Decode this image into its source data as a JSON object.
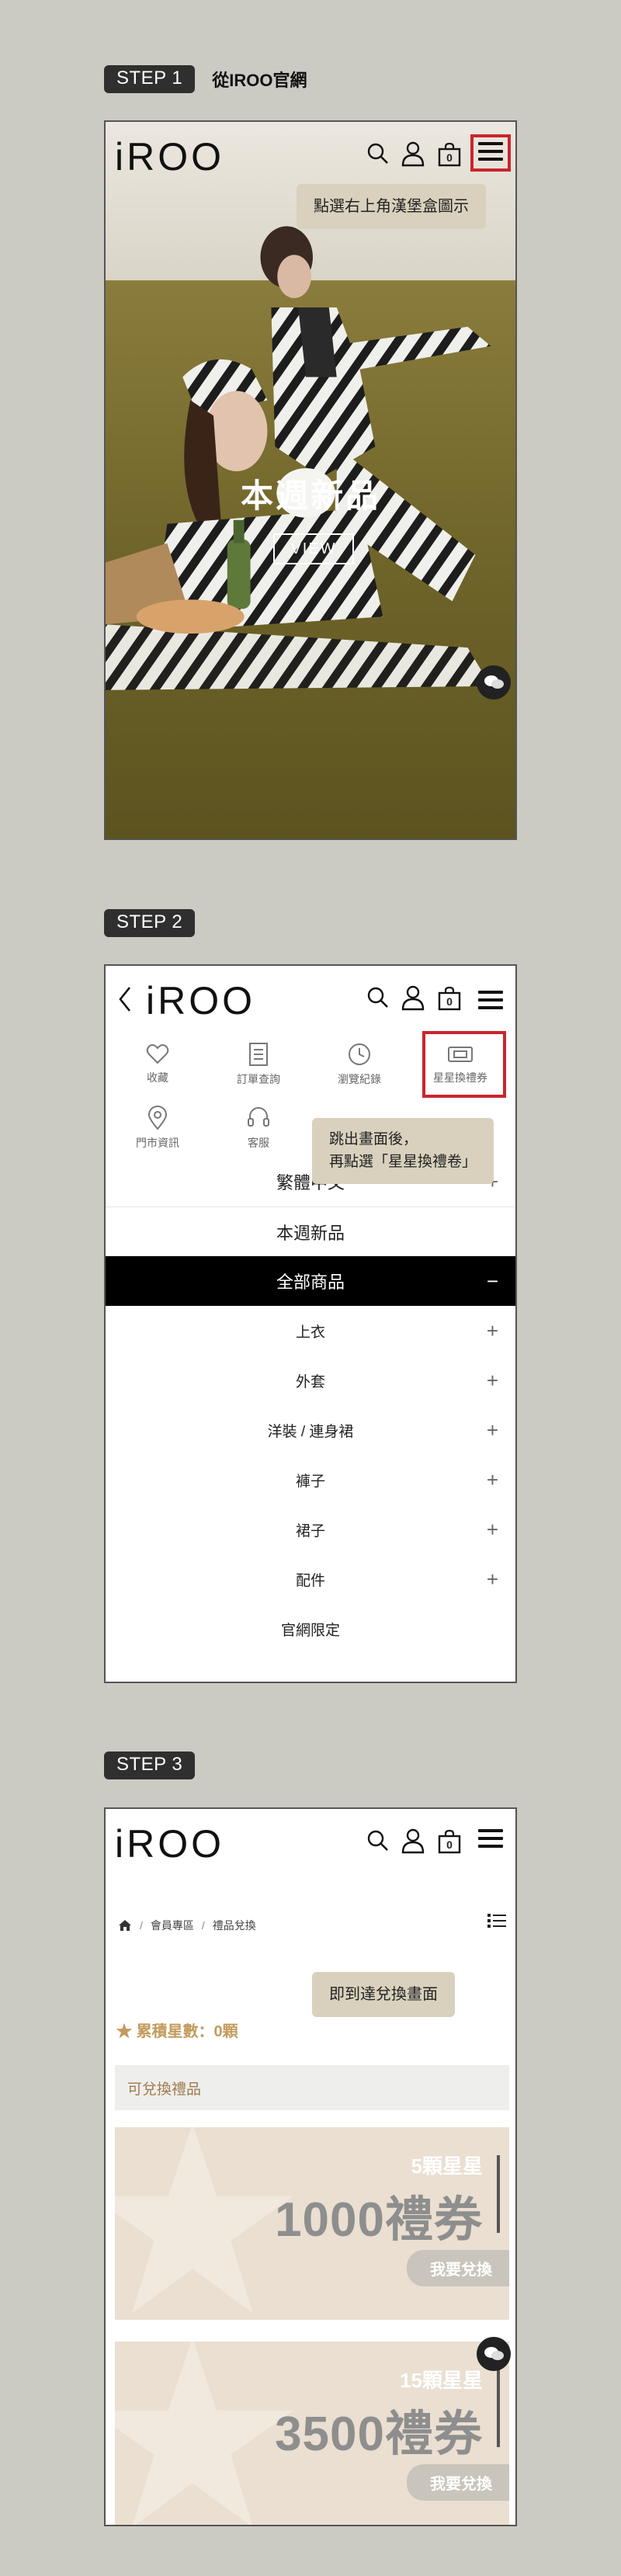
{
  "step1": {
    "label": "STEP 1",
    "text": "從IROO官網",
    "logo": "iROO",
    "cart_count": "0",
    "tooltip": "點選右上角漢堡盒圖示",
    "hero_title": "本週新品",
    "hero_button": "VIEW"
  },
  "step2": {
    "label": "STEP 2",
    "logo": "iROO",
    "cart_count": "0",
    "quick_links": [
      "收藏",
      "訂單查詢",
      "瀏覽紀錄",
      "星星換禮券",
      "門市資訊",
      "客服"
    ],
    "tooltip_line1": "跳出畫面後，",
    "tooltip_line2": "再點選「星星換禮卷」",
    "language": "繁體中文",
    "menu": {
      "new": "本週新品",
      "all": "全部商品",
      "sub": [
        "上衣",
        "外套",
        "洋裝 / 連身裙",
        "褲子",
        "裙子",
        "配件"
      ],
      "exclusive": "官網限定"
    }
  },
  "step3": {
    "label": "STEP 3",
    "logo": "iROO",
    "cart_count": "0",
    "breadcrumb": [
      "會員專區",
      "禮品兌換"
    ],
    "tooltip": "即到達兌換畫面",
    "stars": "累積星數：0顆",
    "section": "可兌換禮品",
    "cards": [
      {
        "qty": "5顆星星",
        "amount": "1000禮券",
        "button": "我要兌換"
      },
      {
        "qty": "15顆星星",
        "amount": "3500禮券",
        "button": "我要兌換"
      }
    ]
  },
  "colors": {
    "accent_red": "#c9252e",
    "tooltip_bg": "#d9d1bd",
    "gold": "#c39b5e",
    "page_bg": "#cbcbc4"
  }
}
